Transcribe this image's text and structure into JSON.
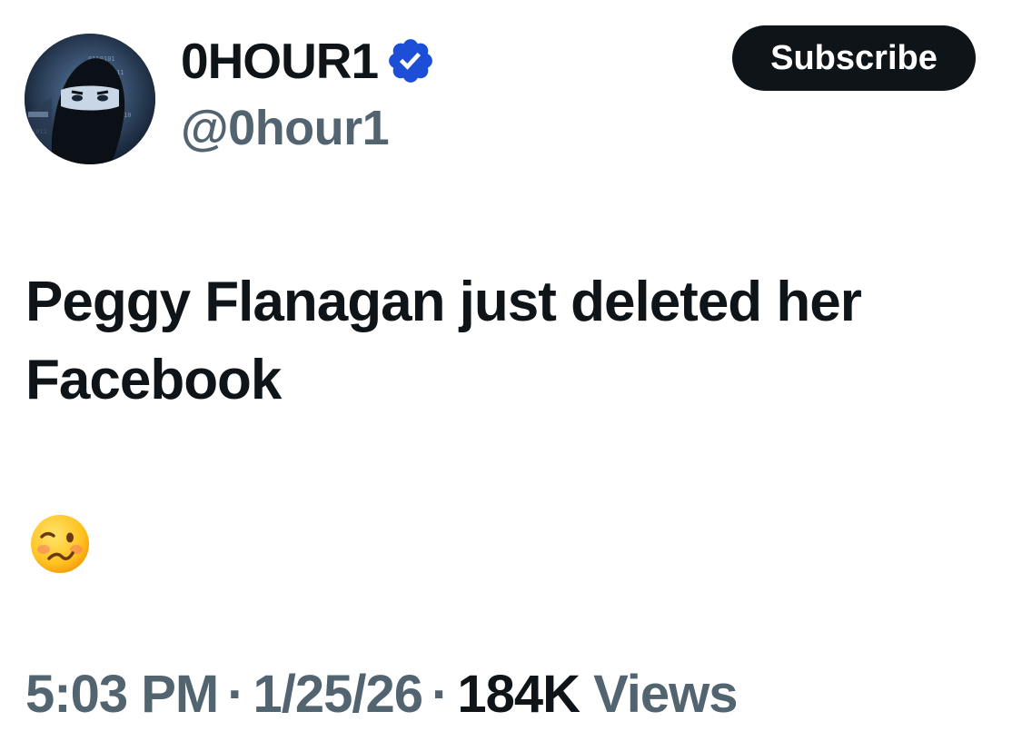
{
  "author": {
    "display_name": "0HOUR1",
    "handle": "@0hour1",
    "verified": true,
    "verified_color": "#1d4ed8",
    "avatar_icon": "hacker-avatar"
  },
  "actions": {
    "subscribe_label": "Subscribe"
  },
  "tweet": {
    "text": "Peggy Flanagan just deleted her Facebook",
    "emoji": "woozy-face-icon"
  },
  "meta": {
    "time": "5:03 PM",
    "separator": "·",
    "date": "1/25/26",
    "views_count": "184K",
    "views_label": "Views"
  },
  "colors": {
    "primary_text": "#0f1419",
    "secondary_text": "#536471",
    "button_bg": "#0f1419"
  }
}
